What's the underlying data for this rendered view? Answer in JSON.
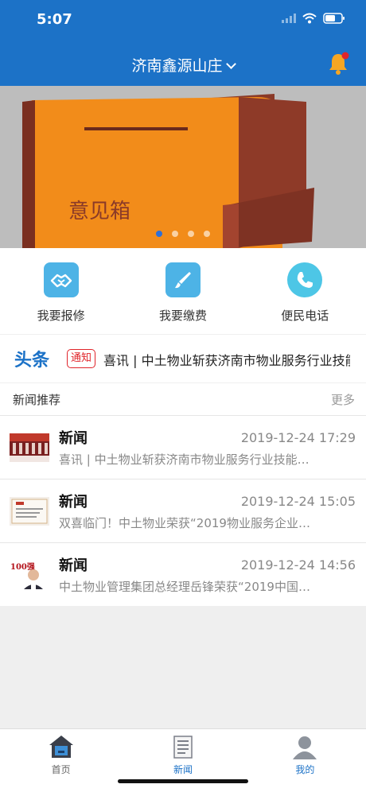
{
  "status_bar": {
    "time": "5:07"
  },
  "header": {
    "community": "济南鑫源山庄"
  },
  "banner": {
    "image_text": "意见箱",
    "slide_count": 4,
    "active_slide": 1
  },
  "quick_actions": [
    {
      "label": "我要报修",
      "icon": "repair-handshake-icon"
    },
    {
      "label": "我要缴费",
      "icon": "pay-brush-icon"
    },
    {
      "label": "便民电话",
      "icon": "phone-icon"
    }
  ],
  "headline": {
    "title": "头条",
    "badge": "通知",
    "text": "喜讯 | 中土物业斩获济南市物业服务行业技能"
  },
  "news": {
    "section_title": "新闻推荐",
    "more_label": "更多",
    "items": [
      {
        "title": "新闻",
        "date": "2019-12-24 17:29",
        "summary": "喜讯 | 中土物业斩获济南市物业服务行业技能…"
      },
      {
        "title": "新闻",
        "date": "2019-12-24 15:05",
        "summary": "双喜临门！中土物业荣获“2019物业服务企业…"
      },
      {
        "title": "新闻",
        "date": "2019-12-24 14:56",
        "summary": "中土物业管理集团总经理岳锋荣获“2019中国…"
      }
    ],
    "thumb3_text": "100强"
  },
  "tabbar": {
    "items": [
      {
        "label": "首页",
        "icon": "home-icon"
      },
      {
        "label": "新闻",
        "icon": "news-icon"
      },
      {
        "label": "我的",
        "icon": "profile-icon"
      }
    ]
  },
  "colors": {
    "primary": "#1c72c7",
    "badge_red": "#e0242a",
    "bell_orange": "#f5a623"
  }
}
